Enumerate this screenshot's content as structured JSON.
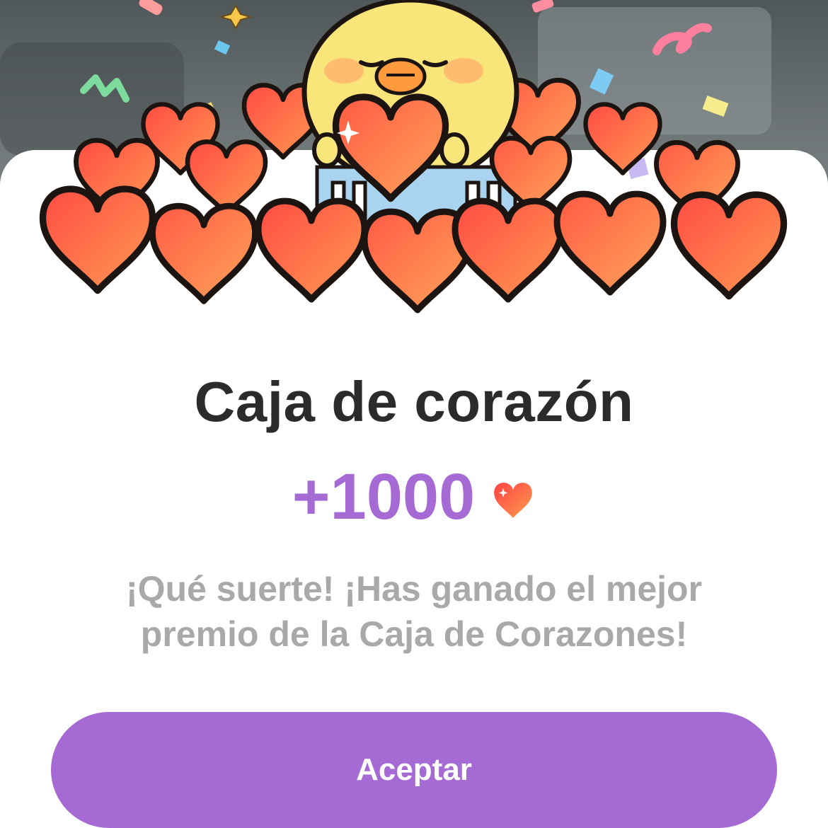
{
  "dialog": {
    "title": "Caja de corazón",
    "reward_amount": "+1000",
    "reward_icon": "heart-icon",
    "message": "¡Qué suerte! ¡Has ganado el mejor premio de la Caja de Corazones!",
    "accept_label": "Aceptar"
  },
  "illustration": {
    "icon": "chick-with-hearts-illustration"
  },
  "colors": {
    "accent": "#a66ad4",
    "title": "#2b2b2b",
    "message": "#a9a9a9",
    "heart_light": "#ff9a52",
    "heart_dark": "#ff4b43",
    "chick": "#f9e57a"
  }
}
